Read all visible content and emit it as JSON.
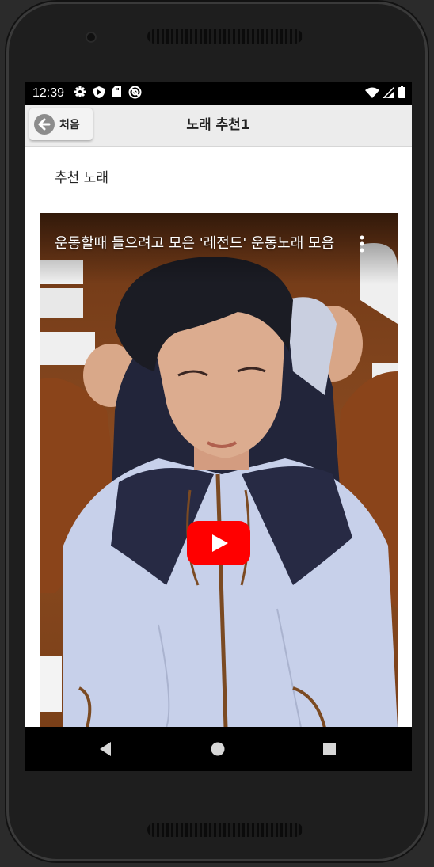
{
  "status_bar": {
    "time": "12:39",
    "left_icons": [
      "gear-icon",
      "shield-play-icon",
      "sd-card-icon",
      "at-sign-icon"
    ],
    "right_icons": [
      "wifi-icon",
      "signal-icon",
      "battery-icon"
    ]
  },
  "app_bar": {
    "back_label": "처음",
    "title": "노래 추천1"
  },
  "content": {
    "section_label": "추천 노래",
    "video": {
      "title": "운동할때 들으려고 모은 '레전드' 운동노래 모음",
      "play_color": "#ff0000"
    }
  },
  "nav_bar": {
    "buttons": [
      "back-triangle-icon",
      "home-circle-icon",
      "recents-square-icon"
    ]
  },
  "colors": {
    "app_bar": "#ececec",
    "video_background": "#8a4a1e",
    "status_bar": "#000000"
  }
}
